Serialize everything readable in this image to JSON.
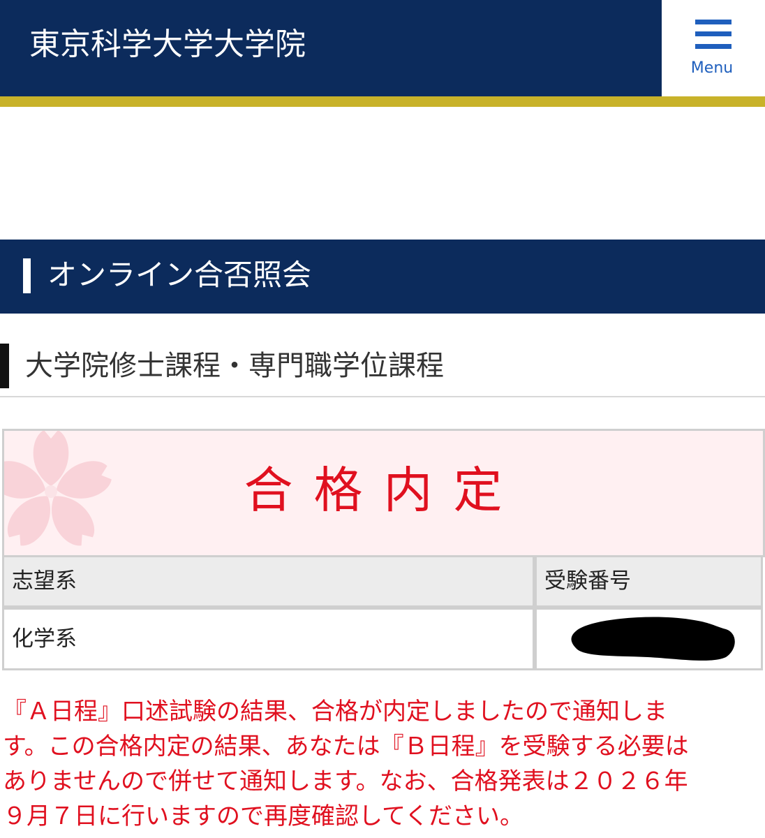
{
  "header": {
    "site_title": "東京科学大学大学院",
    "menu_label": "Menu",
    "menu_icon": "hamburger-menu-icon"
  },
  "colors": {
    "navy": "#0c2b5c",
    "gold": "#c8b22a",
    "menu_blue": "#1f5fbd",
    "result_red": "#e0101f",
    "result_bg": "#fff0f2"
  },
  "section": {
    "title": "オンライン合否照会",
    "subtitle": "大学院修士課程・専門職学位課程"
  },
  "result": {
    "status": "合格内定",
    "decoration_icon": "sakura-flower-icon",
    "table": {
      "headers": [
        "志望系",
        "受験番号"
      ],
      "row": {
        "department": "化学系",
        "exam_number_state": "redacted"
      }
    }
  },
  "notice": {
    "lines": [
      "『Ａ日程』口述試験の結果、合格が内定しましたので通知しま",
      "す。この合格内定の結果、あなたは『Ｂ日程』を受験する必要は",
      "ありませんので併せて通知します。なお、合格発表は２０２６年",
      "９月７日に行いますので再度確認してください。"
    ]
  }
}
